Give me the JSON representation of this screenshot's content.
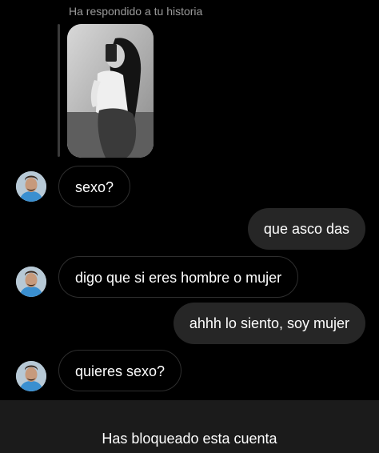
{
  "story": {
    "caption": "Ha respondido a tu historia"
  },
  "messages": [
    {
      "direction": "in",
      "text": "sexo?"
    },
    {
      "direction": "out",
      "text": "que asco das"
    },
    {
      "direction": "in",
      "text": "digo que si eres hombre o mujer"
    },
    {
      "direction": "out",
      "text": "ahhh lo siento, soy mujer"
    },
    {
      "direction": "in",
      "text": "quieres sexo?"
    }
  ],
  "footer": {
    "blocked_notice": "Has bloqueado esta cuenta"
  },
  "colors": {
    "background": "#000000",
    "outgoing_bubble": "#262626",
    "incoming_bubble_border": "#2e2e2e",
    "caption_text": "#9a9a9a",
    "footer_bar": "#1b1b1b"
  }
}
